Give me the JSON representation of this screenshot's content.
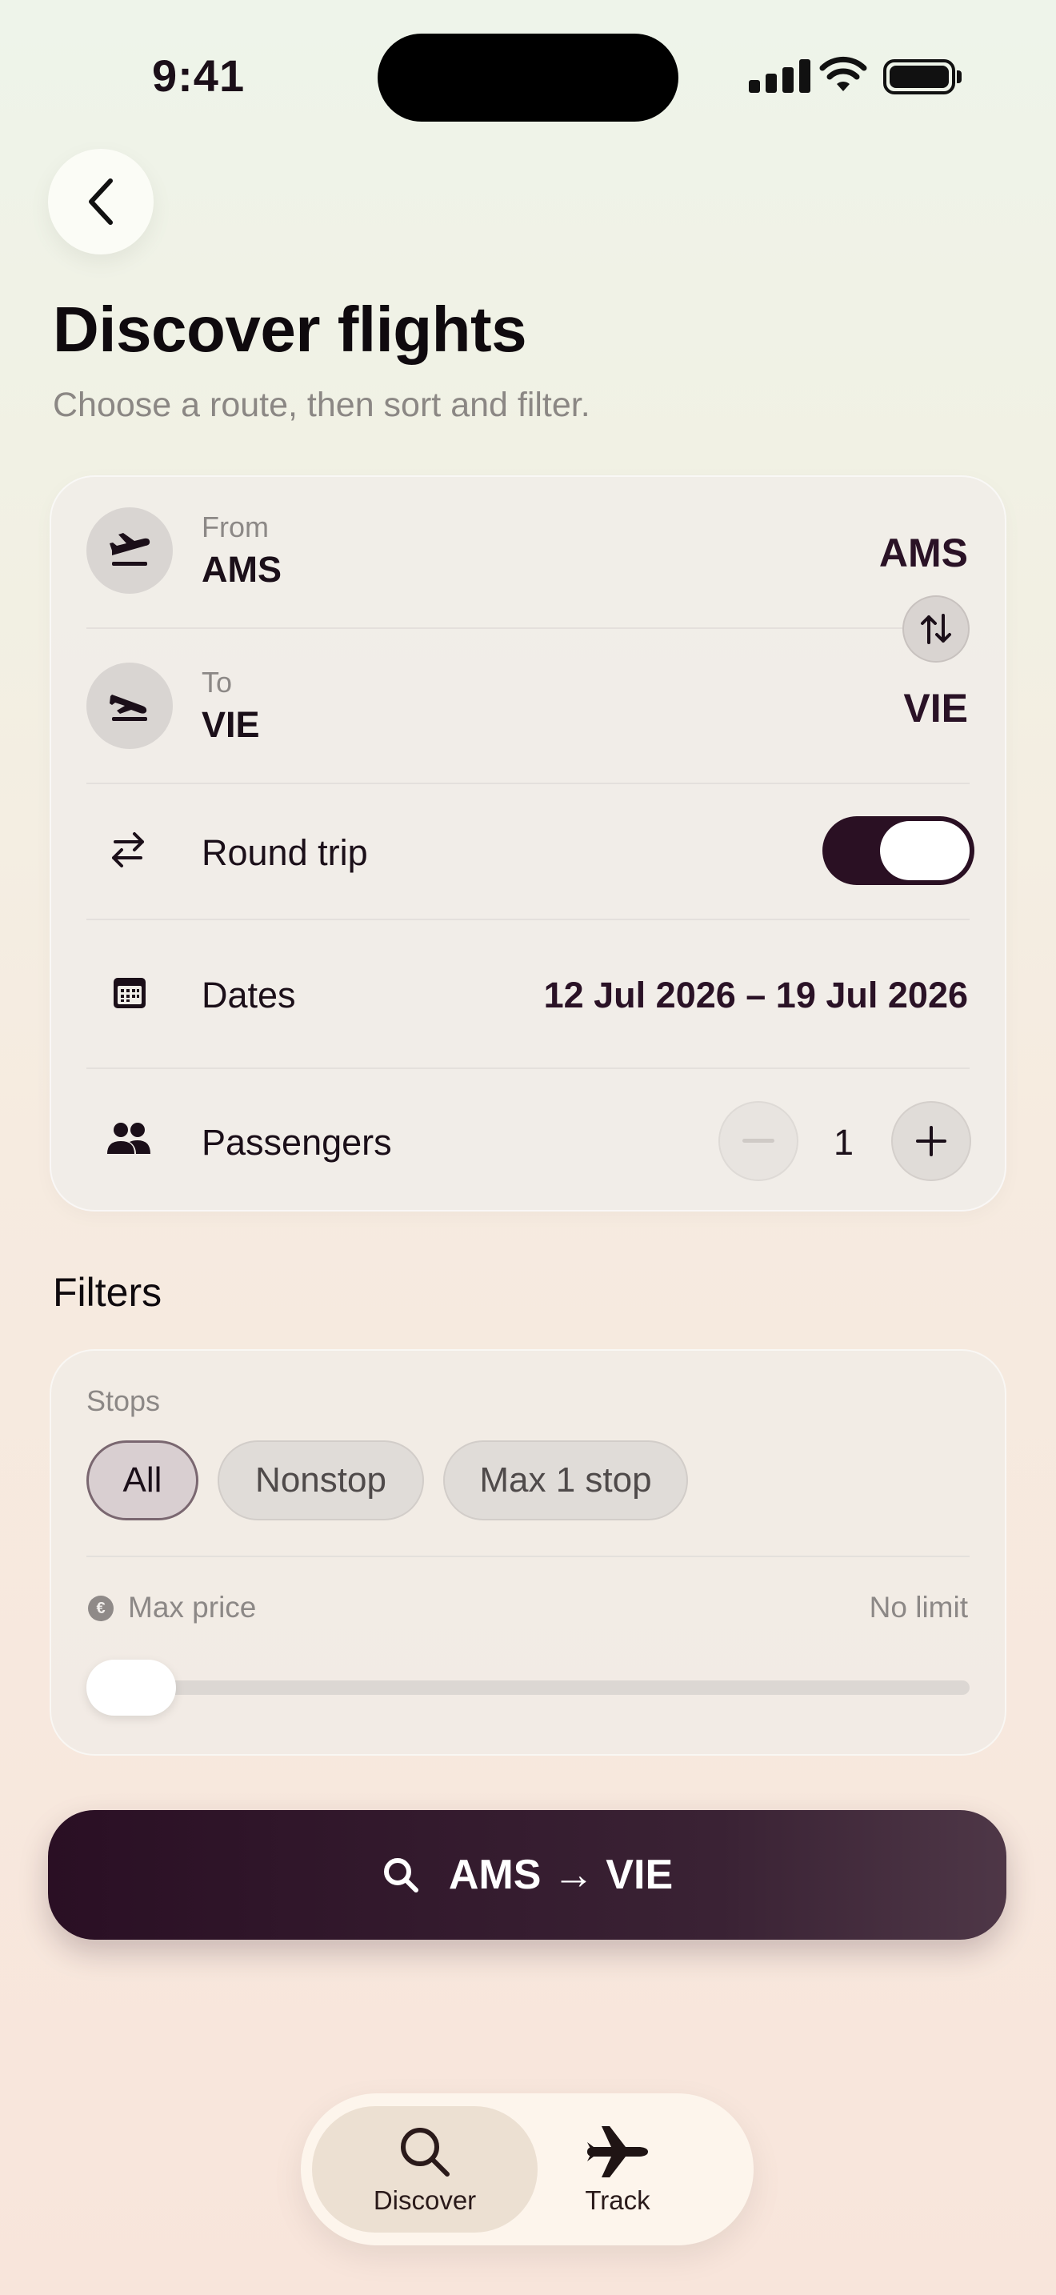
{
  "status_bar": {
    "time": "9:41"
  },
  "header": {
    "title": "Discover flights",
    "subtitle": "Choose a route, then sort and filter."
  },
  "route": {
    "from_label": "From",
    "from_value": "AMS",
    "from_code": "AMS",
    "to_label": "To",
    "to_value": "VIE",
    "to_code": "VIE",
    "round_trip_label": "Round trip",
    "round_trip_on": true,
    "dates_label": "Dates",
    "dates_value": "12 Jul 2026 – 19 Jul 2026",
    "passengers_label": "Passengers",
    "passengers_count": "1"
  },
  "filters": {
    "heading": "Filters",
    "stops_label": "Stops",
    "stops_options": [
      "All",
      "Nonstop",
      "Max 1 stop"
    ],
    "stops_selected": "All",
    "max_price_label": "Max price",
    "max_price_value": "No limit",
    "currency_symbol": "€",
    "price_slider_fraction": 0
  },
  "search_button": {
    "label": "AMS → VIE"
  },
  "tabbar": {
    "tabs": [
      {
        "label": "Discover",
        "icon": "search-icon",
        "active": true
      },
      {
        "label": "Track",
        "icon": "airplane-icon",
        "active": false
      }
    ]
  },
  "colors": {
    "accent": "#2a1023",
    "background_top": "#eef4ea",
    "background_bottom": "#f8e5db",
    "card": "#f0ede8"
  }
}
